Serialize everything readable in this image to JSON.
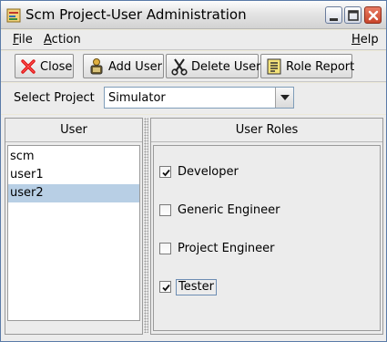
{
  "window": {
    "title": "Scm Project-User Administration",
    "icons": {
      "app": "app-icon",
      "minimize": "minimize-icon",
      "maximize": "maximize-icon",
      "close": "close-icon"
    }
  },
  "menubar": {
    "file": {
      "label": "File",
      "mnemonic": "F",
      "rest": "ile"
    },
    "action": {
      "label": "Action",
      "mnemonic": "A",
      "rest": "ction"
    },
    "help": {
      "label": "Help",
      "mnemonic": "H",
      "rest": "elp"
    }
  },
  "toolbar": {
    "close": {
      "label": "Close",
      "icon": "red-x-icon"
    },
    "add_user": {
      "label": "Add User",
      "icon": "add-user-icon"
    },
    "delete_user": {
      "label": "Delete User",
      "icon": "scissors-icon"
    },
    "role_report": {
      "label": "Role Report",
      "icon": "report-icon"
    }
  },
  "project": {
    "label": "Select Project",
    "selected": "Simulator"
  },
  "users": {
    "header": "User",
    "items": [
      "scm",
      "user1",
      "user2"
    ],
    "selected": "user2"
  },
  "roles": {
    "header": "User Roles",
    "items": [
      {
        "label": "Developer",
        "checked": true
      },
      {
        "label": "Generic Engineer",
        "checked": false
      },
      {
        "label": "Project Engineer",
        "checked": false
      },
      {
        "label": "Tester",
        "checked": true
      }
    ]
  },
  "colors": {
    "selection": "#b8cfe5",
    "close_button": "#c9452a"
  }
}
